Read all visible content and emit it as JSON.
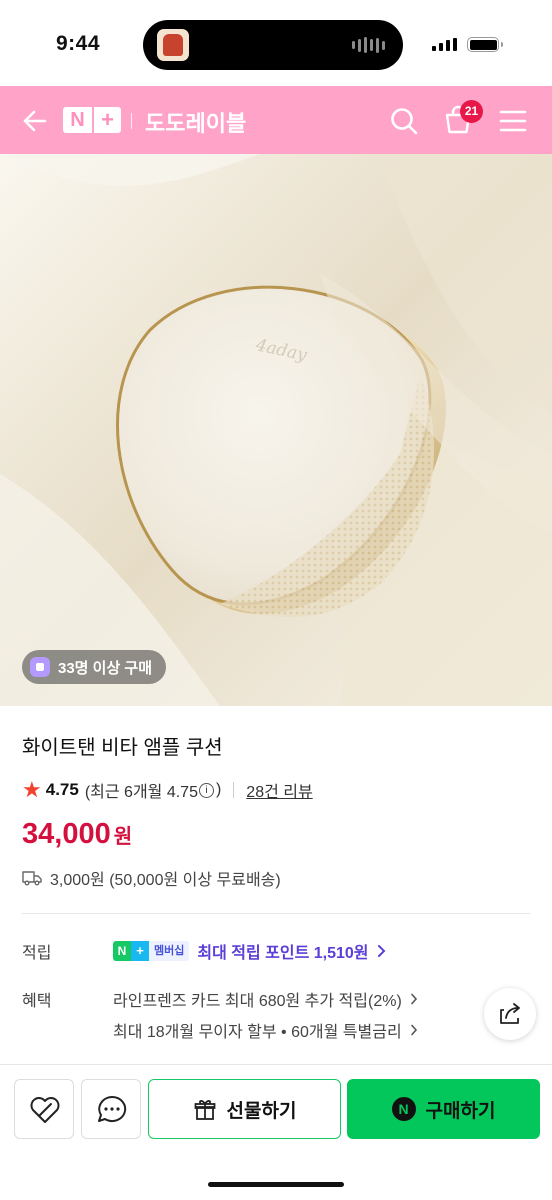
{
  "status_bar": {
    "time": "9:44"
  },
  "header": {
    "logo_n": "N",
    "logo_plus": "+",
    "store_name": "도도레이블",
    "cart_count": "21",
    "background": "#ffa3c8"
  },
  "hero": {
    "image_text": "4aday",
    "buy_badge": "33명 이상 구매"
  },
  "product": {
    "title": "화이트탠 비타 앰플 쿠션",
    "rating": "4.75",
    "rating_recent": "(최근 6개월 4.75",
    "rating_recent_close": ")",
    "reviews": "28건 리뷰",
    "price": "34,000",
    "currency": "원",
    "shipping": "3,000원 (50,000원 이상 무료배송)"
  },
  "benefits": {
    "points_label": "적립",
    "membership_badge": "멤버십",
    "points_text": "최대 적립 포인트 1,510원",
    "benefit_label": "혜택",
    "benefit_line1": "라인프렌즈 카드 최대 680원 추가 적립(2%)",
    "benefit_line2": "최대 18개월 무이자 할부 • 60개월 특별금리"
  },
  "actions": {
    "gift_label": "선물하기",
    "buy_label": "구매하기",
    "buy_n": "N"
  },
  "colors": {
    "price": "#d4103e",
    "buy_button": "#03c75a",
    "points_text": "#5b3fd6"
  },
  "icons": [
    "back-arrow-icon",
    "search-icon",
    "cart-icon",
    "menu-icon",
    "star-icon",
    "info-icon",
    "truck-icon",
    "chevron-right-icon",
    "share-icon",
    "heart-icon",
    "chat-icon",
    "gift-icon"
  ]
}
